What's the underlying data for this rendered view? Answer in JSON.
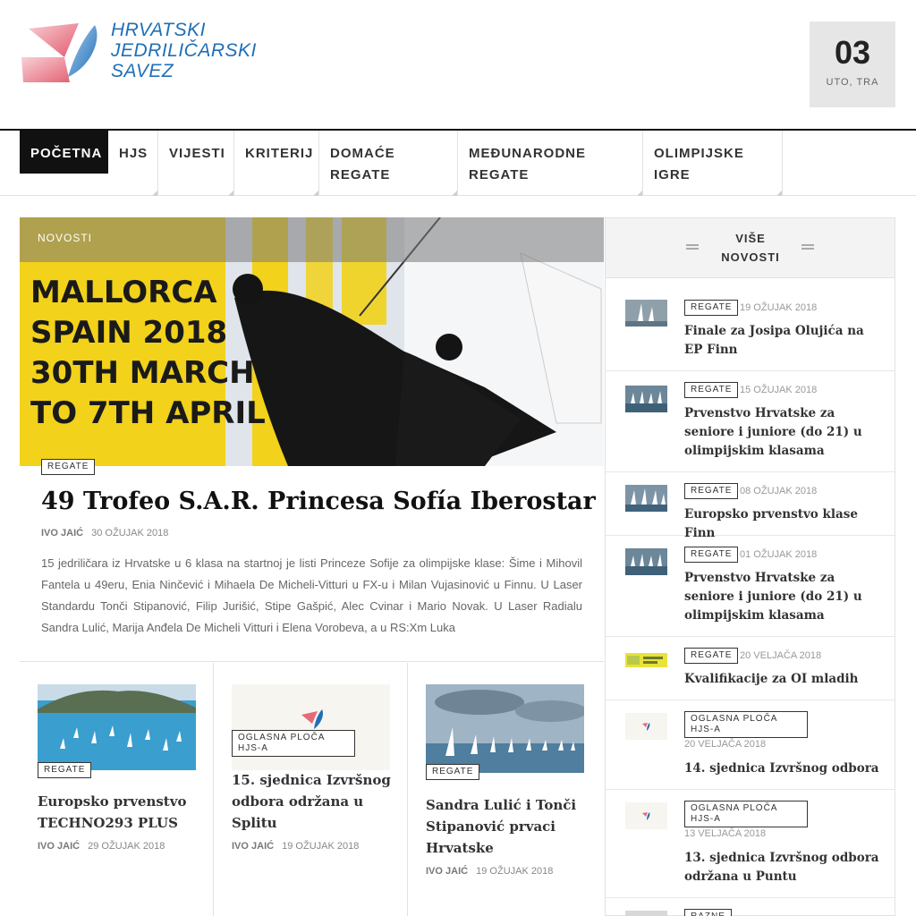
{
  "header": {
    "logo_lines": [
      "HRVATSKI",
      "JEDRILIČARSKI",
      "SAVEZ"
    ],
    "date_day": "03",
    "date_sub": "UTO, TRA"
  },
  "nav": {
    "items": [
      "POČETNA",
      "HJS",
      "VIJESTI",
      "KRITERIJ",
      "DOMAĆE\nREGATE",
      "MEĐUNARODNE\nREGATE",
      "OLIMPIJSKE\nIGRE"
    ],
    "active": "POČETNA"
  },
  "featured": {
    "section_label": "NOVOSTI",
    "image_text": [
      "MALLORCA",
      "SPAIN 2018",
      "30TH MARCH",
      "TO 7TH APRIL"
    ],
    "category": "REGATE",
    "title": "49 Trofeo S.A.R. Princesa Sofía Iberostar",
    "author": "IVO JAIĆ",
    "date": "30 OŽUJAK 2018",
    "excerpt": "15 jedriličara iz Hrvatske u 6 klasa na startnoj je listi Princeze Sofije za olimpijske klase: Šime i Mihovil Fantela u 49eru, Enia Ninčević i Mihaela De Micheli-Vitturi u FX-u i Milan Vujasinović u Finnu. U Laser Standardu Tonči Stipanović, Filip Jurišić, Stipe Gašpić, Alec Cvinar i Mario Novak. U Laser Radialu Sandra Lulić, Marija Anđela De Micheli Vitturi i Elena Vorobeva, a u RS:Xm Luka"
  },
  "cards": [
    {
      "category": "REGATE",
      "title": "Europsko prvenstvo TECHNO293 PLUS",
      "author": "IVO JAIĆ",
      "date": "29 OŽUJAK 2018"
    },
    {
      "category": "OGLASNA PLOČA HJS-A",
      "title": "15. sjednica Izvršnog odbora održana u Splitu",
      "author": "IVO JAIĆ",
      "date": "19 OŽUJAK 2018"
    },
    {
      "category": "REGATE",
      "title": "Sandra Lulić i Tonči Stipanović prvaci Hrvatske",
      "author": "IVO JAIĆ",
      "date": "19 OŽUJAK 2018"
    }
  ],
  "sidebar": {
    "title": "VIŠE NOVOSTI",
    "items": [
      {
        "category": "REGATE",
        "date": "19 OŽUJAK 2018",
        "title": "Finale za Josipa Olujića na EP Finn"
      },
      {
        "category": "REGATE",
        "date": "15 OŽUJAK 2018",
        "title": "Prvenstvo Hrvatske za seniore i juniore (do 21) u olimpijskim klasama"
      },
      {
        "category": "REGATE",
        "date": "08 OŽUJAK 2018",
        "title": "Europsko prvenstvo klase Finn"
      },
      {
        "category": "REGATE",
        "date": "01 OŽUJAK 2018",
        "title": "Prvenstvo Hrvatske za seniore i juniore (do 21) u olimpijskim klasama"
      },
      {
        "category": "REGATE",
        "date": "20 VELJAČA 2018",
        "title": "Kvalifikacije za OI mladih"
      },
      {
        "category": "OGLASNA PLOČA HJS-A",
        "date": "20 VELJAČA 2018",
        "title": "14. sjednica Izvršnog odbora"
      },
      {
        "category": "OGLASNA PLOČA HJS-A",
        "date": "13 VELJAČA 2018",
        "title": "13. sjednica Izvršnog odbora održana u Puntu"
      },
      {
        "category": "RAZNE",
        "date": "",
        "title": ""
      }
    ]
  },
  "colors": {
    "brand_blue": "#1f6fb7",
    "logo_red": "#e05060",
    "nav_active_bg": "#111111",
    "date_box_bg": "#e6e6e6",
    "featured_yellow": "#f2d21a"
  }
}
